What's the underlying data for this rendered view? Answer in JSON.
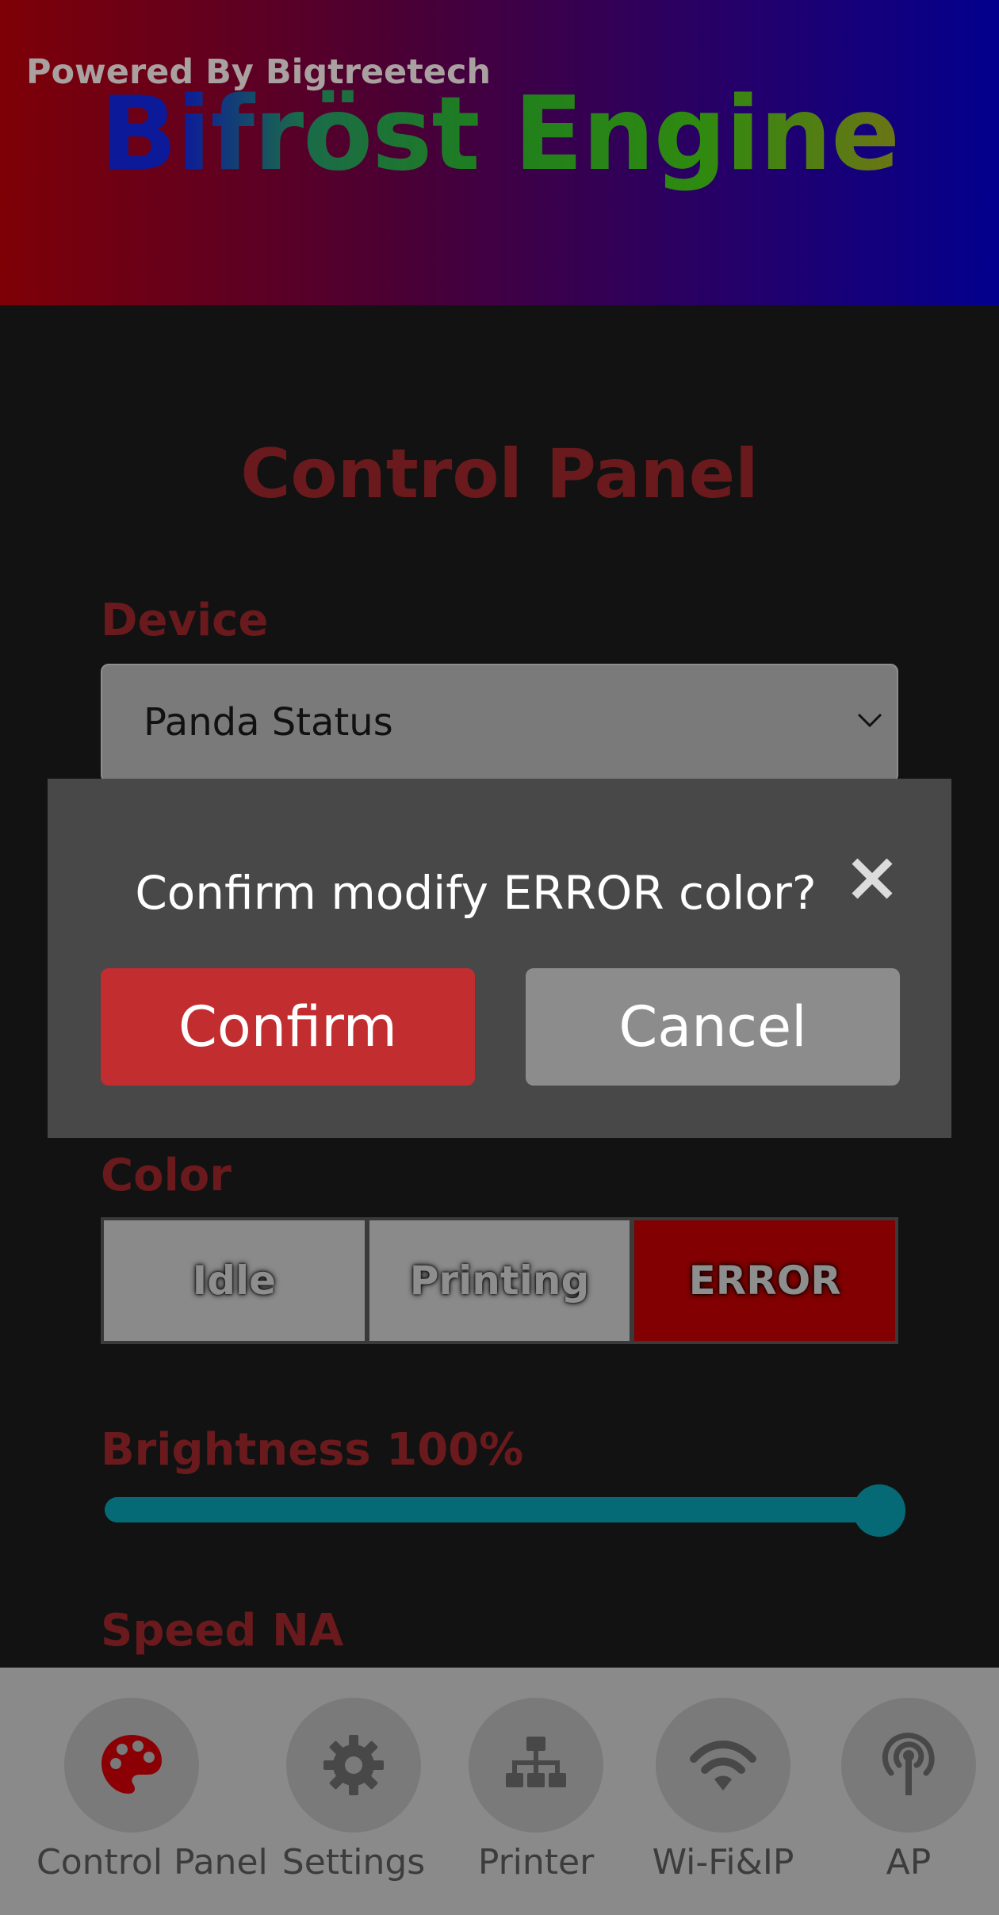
{
  "header": {
    "powered_by": "Powered By Bigtreetech",
    "brand": "Bifröst Engine"
  },
  "main": {
    "title": "Control Panel",
    "device_label": "Device",
    "device_value": "Panda Status",
    "color_label": "Color",
    "color_options": [
      "Idle",
      "Printing",
      "ERROR"
    ],
    "color_selected": "ERROR",
    "brightness_label": "Brightness 100%",
    "brightness_value": 1.0,
    "speed_label": "Speed NA"
  },
  "dialog": {
    "message": "Confirm modify ERROR color?",
    "confirm_label": "Confirm",
    "cancel_label": "Cancel"
  },
  "nav": {
    "items": [
      {
        "label": "Control Panel",
        "icon": "palette-icon"
      },
      {
        "label": "Settings",
        "icon": "gear-icon"
      },
      {
        "label": "Printer",
        "icon": "network-tree-icon"
      },
      {
        "label": "Wi-Fi&IP",
        "icon": "wifi-icon"
      },
      {
        "label": "AP",
        "icon": "antenna-icon"
      }
    ],
    "active": "Control Panel"
  },
  "colors": {
    "accent_red": "#c22d30",
    "selected_error": "#820002",
    "slider": "#066a76",
    "label_red": "#6a1a1c"
  }
}
